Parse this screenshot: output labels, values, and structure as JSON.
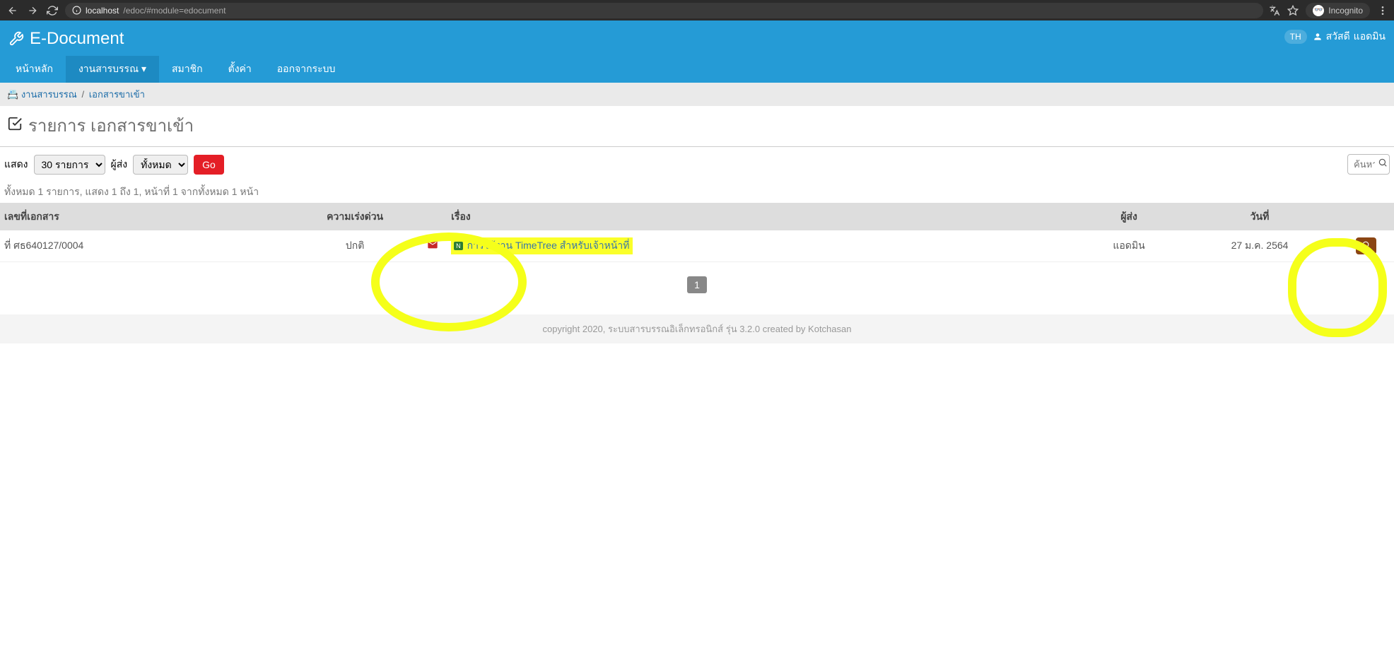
{
  "browser": {
    "url_host": "localhost",
    "url_path": "/edoc/#module=edocument",
    "incognito_label": "Incognito"
  },
  "header": {
    "app_title": "E-Document",
    "lang": "TH",
    "greeting_prefix": "สวัสดี",
    "user_name": "แอดมิน"
  },
  "nav": {
    "items": [
      "หน้าหลัก",
      "งานสารบรรณ",
      "สมาชิก",
      "ตั้งค่า",
      "ออกจากระบบ"
    ],
    "active_index": 1
  },
  "breadcrumb": {
    "items": [
      "งานสารบรรณ",
      "เอกสารขาเข้า"
    ]
  },
  "page": {
    "title": "รายการ เอกสารขาเข้า"
  },
  "toolbar": {
    "show_label": "แสดง",
    "show_select": "30 รายการ",
    "sender_label": "ผู้ส่ง",
    "sender_select": "ทั้งหมด",
    "go_label": "Go",
    "search_placeholder": "ค้นหา"
  },
  "summary": "ทั้งหมด 1 รายการ, แสดง 1 ถึง 1, หน้าที่ 1 จากทั้งหมด 1 หน้า",
  "table": {
    "headers": {
      "doc_no": "เลขที่เอกสาร",
      "priority": "ความเร่งด่วน",
      "subject": "เรื่อง",
      "sender": "ผู้ส่ง",
      "date": "วันที่"
    },
    "rows": [
      {
        "doc_no": "ที่ ศธ640127/0004",
        "priority": "ปกติ",
        "subject": "การใช้งาน TimeTree สำหรับเจ้าหน้าที่",
        "sender": "แอดมิน",
        "date": "27 ม.ค. 2564"
      }
    ]
  },
  "pagination": {
    "current": "1"
  },
  "footer": "copyright 2020, ระบบสารบรรณอิเล็กทรอนิกส์ รุ่น 3.2.0 created by Kotchasan"
}
